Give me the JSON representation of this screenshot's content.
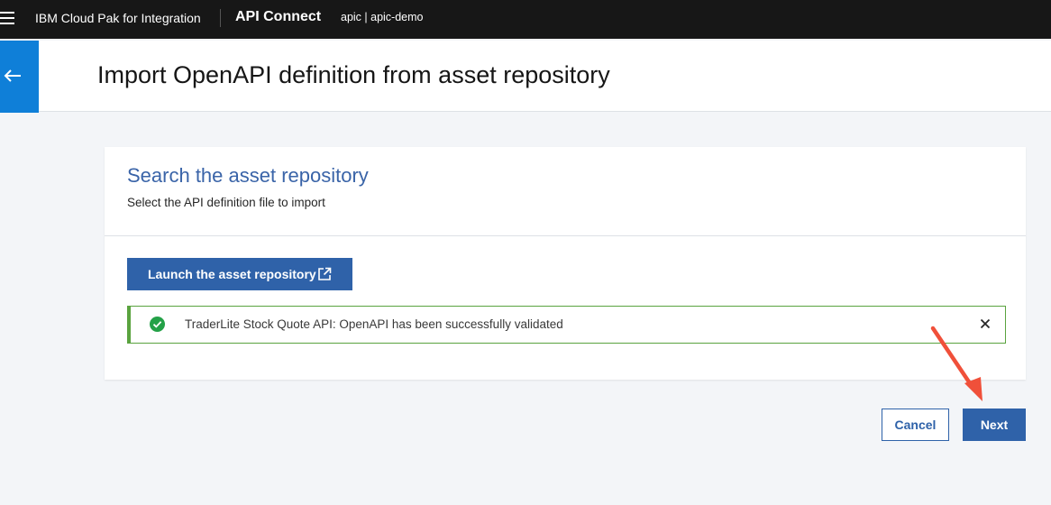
{
  "topbar": {
    "platform_name": "IBM Cloud Pak for Integration",
    "product_name": "API Connect",
    "context": "apic | apic-demo",
    "menu_icon": "hamburger-menu-icon"
  },
  "header": {
    "back_icon": "arrow-left-icon",
    "title": "Import OpenAPI definition from asset repository"
  },
  "card": {
    "title": "Search the asset repository",
    "subtitle": "Select the API definition file to import",
    "launch_button_label": "Launch the asset repository",
    "launch_icon": "external-link-icon",
    "notification": {
      "status": "success",
      "icon": "checkmark-filled-icon",
      "message": "TraderLite Stock Quote API: OpenAPI has been successfully validated",
      "close_icon": "close-icon"
    }
  },
  "footer": {
    "cancel_label": "Cancel",
    "next_label": "Next"
  },
  "colors": {
    "topbar": "#171717",
    "accent_blue": "#2f62a9",
    "back_button": "#0f7fd8",
    "success_green": "#5aa33f",
    "annotation_red": "#f0503a"
  }
}
